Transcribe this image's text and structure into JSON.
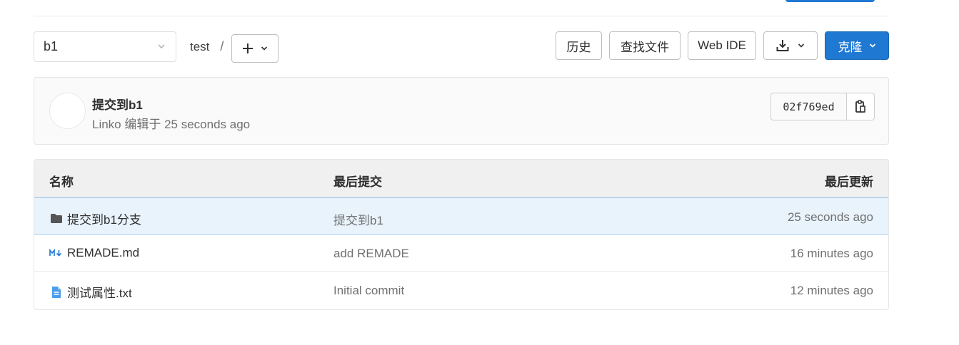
{
  "toolbar": {
    "branch": "b1",
    "path_segment": "test",
    "path_separator": "/",
    "history_label": "历史",
    "find_file_label": "查找文件",
    "web_ide_label": "Web IDE",
    "clone_label": "克隆"
  },
  "commit": {
    "title": "提交到b1",
    "meta": "Linko 编辑于 25 seconds ago",
    "sha": "02f769ed"
  },
  "table": {
    "headers": {
      "name": "名称",
      "last_commit": "最后提交",
      "last_update": "最后更新"
    },
    "rows": [
      {
        "icon": "folder-icon",
        "name": "提交到b1分支",
        "commit": "提交到b1",
        "time": "25 seconds ago"
      },
      {
        "icon": "markdown-icon",
        "name": "REMADE.md",
        "commit": "add REMADE",
        "time": "16 minutes ago"
      },
      {
        "icon": "text-file-icon",
        "name": "测试属性.txt",
        "commit": "Initial commit",
        "time": "12 minutes ago"
      }
    ]
  },
  "colors": {
    "primary": "#1f78d1",
    "selected_row": "#e9f3fc",
    "header_bg": "#f0f0f0"
  }
}
